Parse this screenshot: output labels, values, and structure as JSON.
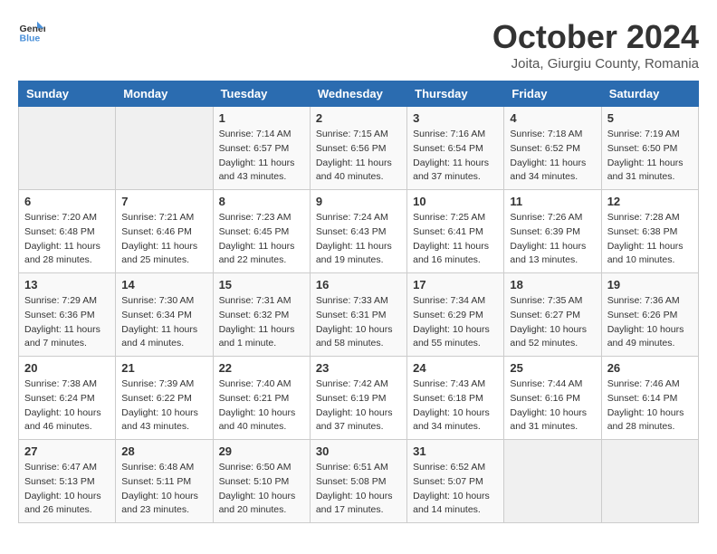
{
  "header": {
    "logo_line1": "General",
    "logo_line2": "Blue",
    "month": "October 2024",
    "location": "Joita, Giurgiu County, Romania"
  },
  "weekdays": [
    "Sunday",
    "Monday",
    "Tuesday",
    "Wednesday",
    "Thursday",
    "Friday",
    "Saturday"
  ],
  "weeks": [
    [
      {
        "day": "",
        "info": ""
      },
      {
        "day": "",
        "info": ""
      },
      {
        "day": "1",
        "info": "Sunrise: 7:14 AM\nSunset: 6:57 PM\nDaylight: 11 hours and 43 minutes."
      },
      {
        "day": "2",
        "info": "Sunrise: 7:15 AM\nSunset: 6:56 PM\nDaylight: 11 hours and 40 minutes."
      },
      {
        "day": "3",
        "info": "Sunrise: 7:16 AM\nSunset: 6:54 PM\nDaylight: 11 hours and 37 minutes."
      },
      {
        "day": "4",
        "info": "Sunrise: 7:18 AM\nSunset: 6:52 PM\nDaylight: 11 hours and 34 minutes."
      },
      {
        "day": "5",
        "info": "Sunrise: 7:19 AM\nSunset: 6:50 PM\nDaylight: 11 hours and 31 minutes."
      }
    ],
    [
      {
        "day": "6",
        "info": "Sunrise: 7:20 AM\nSunset: 6:48 PM\nDaylight: 11 hours and 28 minutes."
      },
      {
        "day": "7",
        "info": "Sunrise: 7:21 AM\nSunset: 6:46 PM\nDaylight: 11 hours and 25 minutes."
      },
      {
        "day": "8",
        "info": "Sunrise: 7:23 AM\nSunset: 6:45 PM\nDaylight: 11 hours and 22 minutes."
      },
      {
        "day": "9",
        "info": "Sunrise: 7:24 AM\nSunset: 6:43 PM\nDaylight: 11 hours and 19 minutes."
      },
      {
        "day": "10",
        "info": "Sunrise: 7:25 AM\nSunset: 6:41 PM\nDaylight: 11 hours and 16 minutes."
      },
      {
        "day": "11",
        "info": "Sunrise: 7:26 AM\nSunset: 6:39 PM\nDaylight: 11 hours and 13 minutes."
      },
      {
        "day": "12",
        "info": "Sunrise: 7:28 AM\nSunset: 6:38 PM\nDaylight: 11 hours and 10 minutes."
      }
    ],
    [
      {
        "day": "13",
        "info": "Sunrise: 7:29 AM\nSunset: 6:36 PM\nDaylight: 11 hours and 7 minutes."
      },
      {
        "day": "14",
        "info": "Sunrise: 7:30 AM\nSunset: 6:34 PM\nDaylight: 11 hours and 4 minutes."
      },
      {
        "day": "15",
        "info": "Sunrise: 7:31 AM\nSunset: 6:32 PM\nDaylight: 11 hours and 1 minute."
      },
      {
        "day": "16",
        "info": "Sunrise: 7:33 AM\nSunset: 6:31 PM\nDaylight: 10 hours and 58 minutes."
      },
      {
        "day": "17",
        "info": "Sunrise: 7:34 AM\nSunset: 6:29 PM\nDaylight: 10 hours and 55 minutes."
      },
      {
        "day": "18",
        "info": "Sunrise: 7:35 AM\nSunset: 6:27 PM\nDaylight: 10 hours and 52 minutes."
      },
      {
        "day": "19",
        "info": "Sunrise: 7:36 AM\nSunset: 6:26 PM\nDaylight: 10 hours and 49 minutes."
      }
    ],
    [
      {
        "day": "20",
        "info": "Sunrise: 7:38 AM\nSunset: 6:24 PM\nDaylight: 10 hours and 46 minutes."
      },
      {
        "day": "21",
        "info": "Sunrise: 7:39 AM\nSunset: 6:22 PM\nDaylight: 10 hours and 43 minutes."
      },
      {
        "day": "22",
        "info": "Sunrise: 7:40 AM\nSunset: 6:21 PM\nDaylight: 10 hours and 40 minutes."
      },
      {
        "day": "23",
        "info": "Sunrise: 7:42 AM\nSunset: 6:19 PM\nDaylight: 10 hours and 37 minutes."
      },
      {
        "day": "24",
        "info": "Sunrise: 7:43 AM\nSunset: 6:18 PM\nDaylight: 10 hours and 34 minutes."
      },
      {
        "day": "25",
        "info": "Sunrise: 7:44 AM\nSunset: 6:16 PM\nDaylight: 10 hours and 31 minutes."
      },
      {
        "day": "26",
        "info": "Sunrise: 7:46 AM\nSunset: 6:14 PM\nDaylight: 10 hours and 28 minutes."
      }
    ],
    [
      {
        "day": "27",
        "info": "Sunrise: 6:47 AM\nSunset: 5:13 PM\nDaylight: 10 hours and 26 minutes."
      },
      {
        "day": "28",
        "info": "Sunrise: 6:48 AM\nSunset: 5:11 PM\nDaylight: 10 hours and 23 minutes."
      },
      {
        "day": "29",
        "info": "Sunrise: 6:50 AM\nSunset: 5:10 PM\nDaylight: 10 hours and 20 minutes."
      },
      {
        "day": "30",
        "info": "Sunrise: 6:51 AM\nSunset: 5:08 PM\nDaylight: 10 hours and 17 minutes."
      },
      {
        "day": "31",
        "info": "Sunrise: 6:52 AM\nSunset: 5:07 PM\nDaylight: 10 hours and 14 minutes."
      },
      {
        "day": "",
        "info": ""
      },
      {
        "day": "",
        "info": ""
      }
    ]
  ]
}
